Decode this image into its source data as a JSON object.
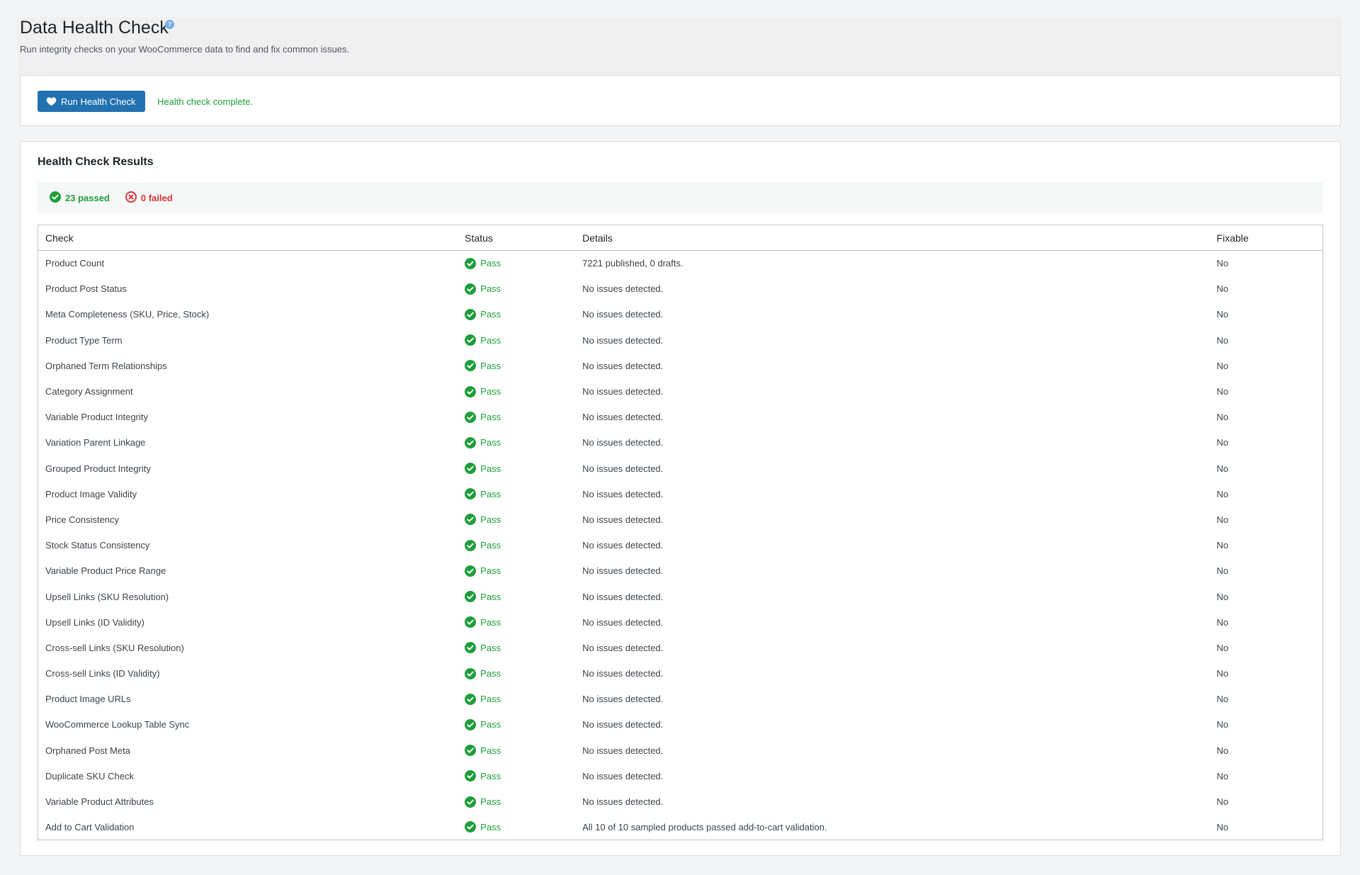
{
  "header": {
    "title": "Data Health Check",
    "subtitle": "Run integrity checks on your WooCommerce data to find and fix common issues."
  },
  "actions": {
    "run_button_label": "Run Health Check",
    "status_message": "Health check complete."
  },
  "results": {
    "title": "Health Check Results",
    "passed_label": "23 passed",
    "failed_label": "0 failed",
    "columns": [
      "Check",
      "Status",
      "Details",
      "Fixable"
    ],
    "rows": [
      {
        "check": "Product Count",
        "status": "Pass",
        "details": "7221 published, 0 drafts.",
        "fixable": "No"
      },
      {
        "check": "Product Post Status",
        "status": "Pass",
        "details": "No issues detected.",
        "fixable": "No"
      },
      {
        "check": "Meta Completeness (SKU, Price, Stock)",
        "status": "Pass",
        "details": "No issues detected.",
        "fixable": "No"
      },
      {
        "check": "Product Type Term",
        "status": "Pass",
        "details": "No issues detected.",
        "fixable": "No"
      },
      {
        "check": "Orphaned Term Relationships",
        "status": "Pass",
        "details": "No issues detected.",
        "fixable": "No"
      },
      {
        "check": "Category Assignment",
        "status": "Pass",
        "details": "No issues detected.",
        "fixable": "No"
      },
      {
        "check": "Variable Product Integrity",
        "status": "Pass",
        "details": "No issues detected.",
        "fixable": "No"
      },
      {
        "check": "Variation Parent Linkage",
        "status": "Pass",
        "details": "No issues detected.",
        "fixable": "No"
      },
      {
        "check": "Grouped Product Integrity",
        "status": "Pass",
        "details": "No issues detected.",
        "fixable": "No"
      },
      {
        "check": "Product Image Validity",
        "status": "Pass",
        "details": "No issues detected.",
        "fixable": "No"
      },
      {
        "check": "Price Consistency",
        "status": "Pass",
        "details": "No issues detected.",
        "fixable": "No"
      },
      {
        "check": "Stock Status Consistency",
        "status": "Pass",
        "details": "No issues detected.",
        "fixable": "No"
      },
      {
        "check": "Variable Product Price Range",
        "status": "Pass",
        "details": "No issues detected.",
        "fixable": "No"
      },
      {
        "check": "Upsell Links (SKU Resolution)",
        "status": "Pass",
        "details": "No issues detected.",
        "fixable": "No"
      },
      {
        "check": "Upsell Links (ID Validity)",
        "status": "Pass",
        "details": "No issues detected.",
        "fixable": "No"
      },
      {
        "check": "Cross-sell Links (SKU Resolution)",
        "status": "Pass",
        "details": "No issues detected.",
        "fixable": "No"
      },
      {
        "check": "Cross-sell Links (ID Validity)",
        "status": "Pass",
        "details": "No issues detected.",
        "fixable": "No"
      },
      {
        "check": "Product Image URLs",
        "status": "Pass",
        "details": "No issues detected.",
        "fixable": "No"
      },
      {
        "check": "WooCommerce Lookup Table Sync",
        "status": "Pass",
        "details": "No issues detected.",
        "fixable": "No"
      },
      {
        "check": "Orphaned Post Meta",
        "status": "Pass",
        "details": "No issues detected.",
        "fixable": "No"
      },
      {
        "check": "Duplicate SKU Check",
        "status": "Pass",
        "details": "No issues detected.",
        "fixable": "No"
      },
      {
        "check": "Variable Product Attributes",
        "status": "Pass",
        "details": "No issues detected.",
        "fixable": "No"
      },
      {
        "check": "Add to Cart Validation",
        "status": "Pass",
        "details": "All 10 of 10 sampled products passed add-to-cart validation.",
        "fixable": "No"
      }
    ]
  },
  "icons": {
    "help": "help-icon",
    "run_button": "heart-icon",
    "pass": "check-circle-icon",
    "fail": "x-circle-icon"
  },
  "colors": {
    "accent": "#2271b1",
    "pass": "#1e9e3b",
    "fail": "#d63638"
  }
}
